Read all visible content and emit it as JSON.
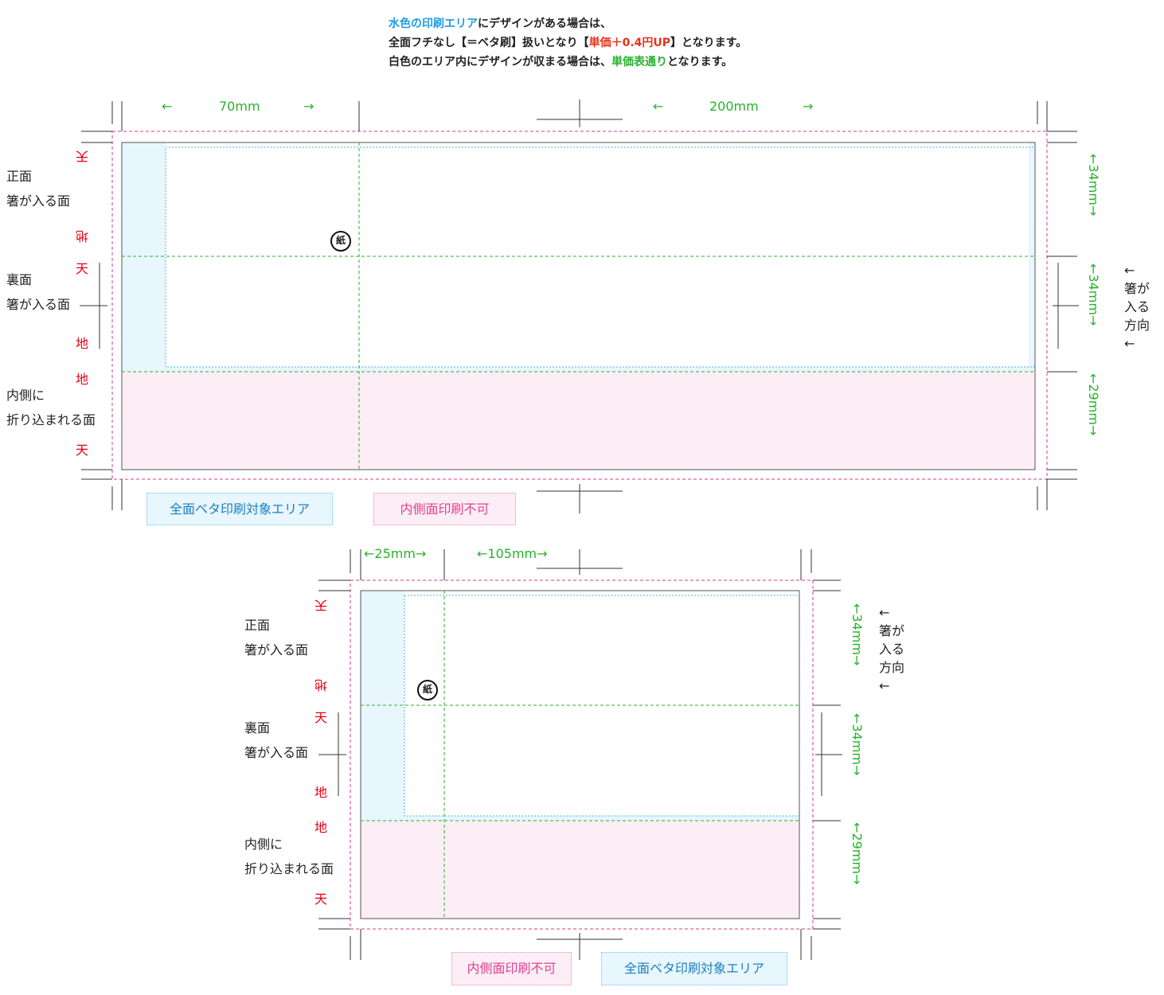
{
  "note": {
    "line1_highlight": "水色の印刷エリア",
    "line1_rest": "にデザインがある場合は、",
    "line2_a": "全面フチなし【＝ベタ刷】扱いとなり【",
    "line2_highlight": "単価＋0.4円UP",
    "line2_b": "】となります。",
    "line3_a": "白色のエリア内にデザインが収まる場合は、",
    "line3_highlight": "単価表通り",
    "line3_b": "となります。"
  },
  "labels": {
    "front_1": "正面",
    "front_2": "箸が入る面",
    "back_1": "裏面",
    "back_2": "箸が入る面",
    "inner_1": "内側に",
    "inner_2": "折り込まれる面",
    "ten": "天",
    "chi": "地",
    "recycle_mark": "紙"
  },
  "direction": {
    "arrow_top": "←",
    "line1": "箸が",
    "line2": "入る",
    "line3": "方向",
    "arrow_bottom": "←"
  },
  "diagram1": {
    "dim_left": "70mm",
    "dim_right": "200mm",
    "dim_v1": "←34mm→",
    "dim_v2": "←34mm→",
    "dim_v3": "←29mm→",
    "arrow_left": "←",
    "arrow_right": "→"
  },
  "diagram2": {
    "dim_left": "←25mm→",
    "dim_right": "←105mm→",
    "dim_v1": "←34mm→",
    "dim_v2": "←34mm→",
    "dim_v3": "←29mm→"
  },
  "legend": {
    "full_print": "全面ベタ印刷対象エリア",
    "no_inner_print": "内側面印刷不可"
  },
  "colors": {
    "blue_area": "#e8f6fd",
    "pink_area": "#fdeef5",
    "trim_line": "#d9388f",
    "guide_line": "#29b22c",
    "safe_line": "#4db6e6"
  }
}
